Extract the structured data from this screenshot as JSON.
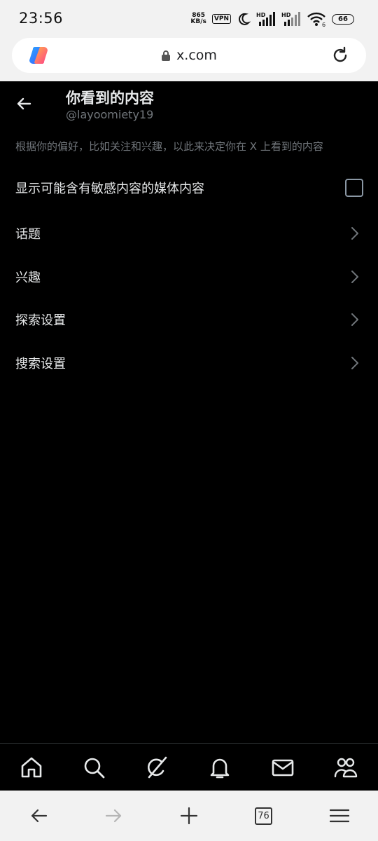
{
  "status_bar": {
    "time": "23:56",
    "speed_value": "865",
    "speed_unit": "KB/s",
    "vpn": "VPN",
    "signal_1_label": "HD",
    "signal_2_label": "HD",
    "wifi_suffix": "6",
    "battery": "66"
  },
  "url_bar": {
    "url": "x.com"
  },
  "header": {
    "title": "你看到的内容",
    "handle": "@layoomiety19"
  },
  "description": "根据你的偏好，比如关注和兴趣，以此来决定你在 X 上看到的内容",
  "settings": {
    "sensitive_media_label": "显示可能含有敏感内容的媒体内容",
    "sensitive_media_checked": false,
    "items": [
      {
        "label": "话题"
      },
      {
        "label": "兴趣"
      },
      {
        "label": "探索设置"
      },
      {
        "label": "搜索设置"
      }
    ]
  },
  "bottom_nav": {
    "icons": [
      "home-icon",
      "search-icon",
      "grok-icon",
      "notifications-icon",
      "messages-icon",
      "communities-icon"
    ]
  },
  "browser_bar": {
    "tab_count": "76"
  },
  "colors": {
    "background": "#000000",
    "primary_text": "#e7e9ea",
    "secondary_text": "#71767b",
    "chrome_bar": "#f2f2f2"
  }
}
